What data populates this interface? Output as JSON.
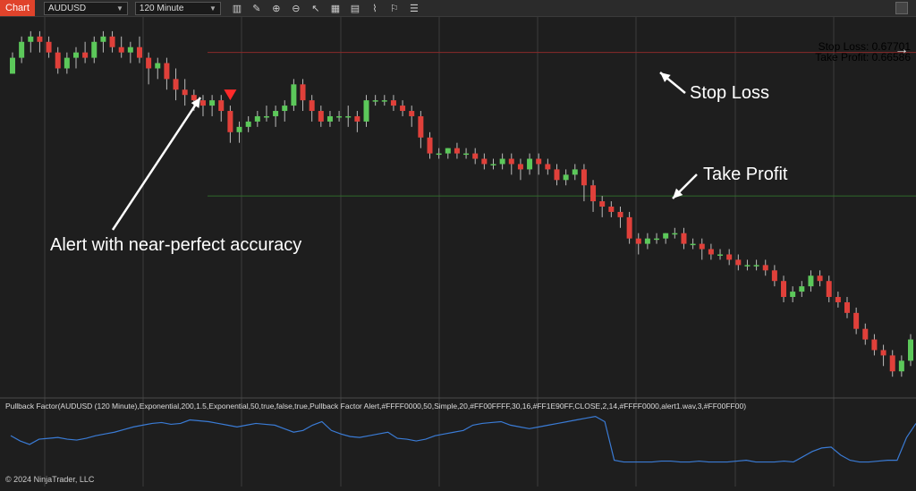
{
  "toolbar": {
    "tab_label": "Chart",
    "instrument": "AUDUSD",
    "interval": "120 Minute",
    "icons": [
      "bars-icon",
      "pencil-icon",
      "zoom-in-icon",
      "zoom-out-icon",
      "cursor-icon",
      "chart-properties-icon",
      "data-box-icon",
      "strategy-icon",
      "alert-icon",
      "list-icon"
    ]
  },
  "annotations": {
    "alert_text": "Alert with near-perfect accuracy",
    "stop_loss_text": "Stop Loss",
    "take_profit_text": "Take Profit"
  },
  "sltp": {
    "stop_loss": "Stop Loss: 0.67701",
    "take_profit": "Take Profit: 0.66586"
  },
  "indicator_label": "Pullback Factor(AUDUSD (120 Minute),Exponential,200,1.5,Exponential,50,true,false,true,Pullback Factor Alert,#FFFF0000,50,Simple,20,#FF00FFFF,30,16,#FF1E90FF,CLOSE,2,14,#FFFF0000,alert1.wav,3,#FF00FF00)",
  "copyright": "© 2024 NinjaTrader, LLC",
  "colors": {
    "up": "#5cc85a",
    "down": "#e0403a",
    "stop_line": "#8a2a2a",
    "tp_line": "#2f6a2a",
    "indicator": "#3a7bd5",
    "stop_text": "#ff4a4a",
    "tp_text": "#6dff6d"
  },
  "chart_data": {
    "type": "candlestick",
    "candles": [
      [
        40,
        43,
        40,
        44
      ],
      [
        43,
        46,
        42,
        47
      ],
      [
        46,
        47,
        44,
        48
      ],
      [
        47,
        46,
        44,
        48
      ],
      [
        46,
        44,
        43,
        47
      ],
      [
        44,
        41,
        40,
        45
      ],
      [
        41,
        43,
        40,
        44
      ],
      [
        43,
        44,
        41,
        45
      ],
      [
        44,
        43,
        42,
        46
      ],
      [
        43,
        46,
        42,
        47
      ],
      [
        46,
        47,
        44,
        48
      ],
      [
        47,
        45,
        44,
        48
      ],
      [
        45,
        44,
        43,
        47
      ],
      [
        44,
        45,
        42,
        46
      ],
      [
        45,
        43,
        42,
        47
      ],
      [
        43,
        41,
        38,
        44
      ],
      [
        41,
        42,
        39,
        43
      ],
      [
        42,
        39,
        37,
        43
      ],
      [
        39,
        37,
        35,
        41
      ],
      [
        37,
        36,
        34,
        39
      ],
      [
        36,
        35,
        33,
        37
      ],
      [
        35,
        34,
        32,
        36
      ],
      [
        34,
        35,
        32,
        36
      ],
      [
        35,
        33,
        31,
        36
      ],
      [
        33,
        29,
        27,
        34
      ],
      [
        29,
        30,
        27,
        31
      ],
      [
        30,
        31,
        29,
        32
      ],
      [
        31,
        32,
        30,
        33
      ],
      [
        32,
        32,
        31,
        34
      ],
      [
        32,
        33,
        30,
        34
      ],
      [
        33,
        34,
        31,
        35
      ],
      [
        34,
        38,
        33,
        39
      ],
      [
        38,
        35,
        33,
        39
      ],
      [
        35,
        33,
        31,
        36
      ],
      [
        33,
        31,
        30,
        34
      ],
      [
        31,
        32,
        30,
        33
      ],
      [
        32,
        32,
        31,
        33
      ],
      [
        32,
        32,
        30,
        34
      ],
      [
        32,
        31,
        29,
        33
      ],
      [
        31,
        35,
        30,
        36
      ],
      [
        35,
        35,
        34,
        36
      ],
      [
        35,
        35,
        34,
        36
      ],
      [
        35,
        34,
        33,
        36
      ],
      [
        34,
        33,
        32,
        35
      ],
      [
        33,
        32,
        30,
        34
      ],
      [
        32,
        28,
        26,
        33
      ],
      [
        28,
        25,
        24,
        29
      ],
      [
        25,
        25,
        24,
        26
      ],
      [
        25,
        26,
        24,
        26
      ],
      [
        26,
        25,
        24,
        27
      ],
      [
        25,
        25,
        24,
        26
      ],
      [
        25,
        24,
        23,
        26
      ],
      [
        24,
        23,
        22,
        25
      ],
      [
        23,
        23,
        22,
        24
      ],
      [
        23,
        24,
        22,
        25
      ],
      [
        24,
        23,
        21,
        25
      ],
      [
        23,
        22,
        20,
        24
      ],
      [
        22,
        24,
        21,
        25
      ],
      [
        24,
        23,
        21,
        25
      ],
      [
        23,
        22,
        21,
        24
      ],
      [
        22,
        20,
        19,
        23
      ],
      [
        20,
        21,
        19,
        22
      ],
      [
        21,
        22,
        20,
        23
      ],
      [
        22,
        19,
        16,
        23
      ],
      [
        19,
        16,
        14,
        20
      ],
      [
        16,
        15,
        13,
        17
      ],
      [
        15,
        14,
        13,
        16
      ],
      [
        14,
        13,
        11,
        15
      ],
      [
        13,
        9,
        8,
        14
      ],
      [
        9,
        8,
        6,
        10
      ],
      [
        8,
        9,
        7,
        10
      ],
      [
        9,
        9,
        8,
        10
      ],
      [
        9,
        10,
        8,
        10
      ],
      [
        10,
        10,
        9,
        11
      ],
      [
        10,
        8,
        7,
        11
      ],
      [
        8,
        8,
        7,
        9
      ],
      [
        8,
        7,
        5,
        9
      ],
      [
        7,
        6,
        5,
        8
      ],
      [
        6,
        6,
        5,
        7
      ],
      [
        6,
        5,
        4,
        7
      ],
      [
        5,
        4,
        3,
        6
      ],
      [
        4,
        4,
        3,
        5
      ],
      [
        4,
        4,
        3,
        5
      ],
      [
        4,
        3,
        2,
        5
      ],
      [
        3,
        1,
        0,
        4
      ],
      [
        1,
        -2,
        -3,
        2
      ],
      [
        -2,
        -1,
        -3,
        0
      ],
      [
        -1,
        0,
        -2,
        1
      ],
      [
        0,
        2,
        -1,
        3
      ],
      [
        2,
        1,
        0,
        3
      ],
      [
        1,
        -2,
        -3,
        2
      ],
      [
        -2,
        -3,
        -4,
        -1
      ],
      [
        -3,
        -5,
        -6,
        -2
      ],
      [
        -5,
        -8,
        -9,
        -4
      ],
      [
        -8,
        -10,
        -11,
        -7
      ],
      [
        -10,
        -12,
        -13,
        -9
      ],
      [
        -12,
        -13,
        -15,
        -11
      ],
      [
        -13,
        -16,
        -17,
        -12
      ],
      [
        -16,
        -14,
        -17,
        -13
      ],
      [
        -14,
        -10,
        -15,
        -9
      ]
    ],
    "stop_loss_level": 44,
    "take_profit_level": 17,
    "alert_candle_index": 24,
    "indicator": {
      "values": [
        58,
        52,
        48,
        54,
        55,
        56,
        54,
        53,
        55,
        58,
        60,
        62,
        65,
        68,
        70,
        72,
        73,
        71,
        72,
        76,
        75,
        74,
        72,
        70,
        68,
        70,
        72,
        71,
        70,
        66,
        62,
        64,
        70,
        74,
        64,
        60,
        57,
        56,
        58,
        60,
        62,
        55,
        54,
        52,
        54,
        58,
        60,
        62,
        64,
        70,
        72,
        73,
        74,
        70,
        68,
        66,
        68,
        70,
        72,
        74,
        76,
        78,
        80,
        74,
        30,
        28,
        28,
        28,
        28,
        29,
        29,
        28,
        28,
        29,
        28,
        28,
        28,
        29,
        30,
        28,
        28,
        28,
        29,
        28,
        34,
        40,
        44,
        45,
        36,
        30,
        28,
        28,
        29,
        30,
        30,
        56,
        72
      ]
    }
  }
}
